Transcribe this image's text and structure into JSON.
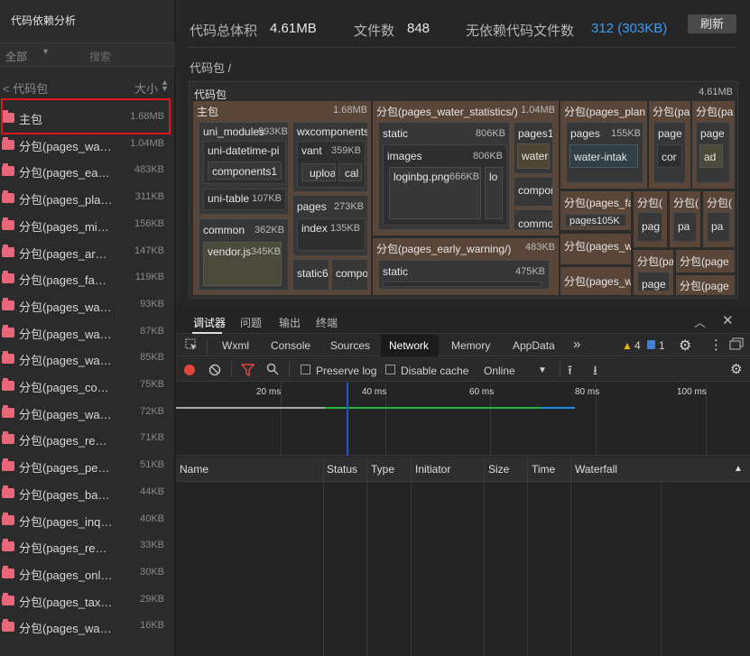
{
  "sidebar": {
    "title": "代码依赖分析",
    "filter_select": "全部",
    "search_placeholder": "搜索",
    "back_label": "< 代码包",
    "size_header": "大小",
    "items": [
      {
        "name": "主包",
        "size": "1.68MB"
      },
      {
        "name": "分包(pages_wat...",
        "size": "1.04MB"
      },
      {
        "name": "分包(pages_early...",
        "size": "483KB"
      },
      {
        "name": "分包(pages_plan/)",
        "size": "311KB"
      },
      {
        "name": "分包(pages_min...",
        "size": "156KB"
      },
      {
        "name": "分包(pages_archi...",
        "size": "147KB"
      },
      {
        "name": "分包(pages_fault...",
        "size": "119KB"
      },
      {
        "name": "分包(pages_water...",
        "size": "93KB"
      },
      {
        "name": "分包(pages_water...",
        "size": "87KB"
      },
      {
        "name": "分包(pages_water...",
        "size": "85KB"
      },
      {
        "name": "分包(pages_consu...",
        "size": "75KB"
      },
      {
        "name": "分包(pages_water...",
        "size": "72KB"
      },
      {
        "name": "分包(pages_recor...",
        "size": "71KB"
      },
      {
        "name": "分包(pages_permi...",
        "size": "51KB"
      },
      {
        "name": "分包(pages_baro...",
        "size": "44KB"
      },
      {
        "name": "分包(pages_inquir...",
        "size": "40KB"
      },
      {
        "name": "分包(pages_regist...",
        "size": "33KB"
      },
      {
        "name": "分包(pages_onlin...",
        "size": "30KB"
      },
      {
        "name": "分包(pages_taxes...",
        "size": "29KB"
      },
      {
        "name": "分包(pages_water...",
        "size": "16KB"
      }
    ]
  },
  "stats": {
    "total_label": "代码总体积",
    "total_value": "4.61MB",
    "files_label": "文件数",
    "files_value": "848",
    "nodep_label": "无依赖代码文件数",
    "nodep_value": "312 (303KB)",
    "refresh_label": "刷新"
  },
  "breadcrumb": "代码包 /",
  "treemap": {
    "title": "代码包",
    "size": "4.61MB",
    "main": {
      "label": "主包",
      "size": "1.68MB"
    },
    "uni_modules": {
      "label": "uni_modules",
      "size": "593KB"
    },
    "uni_datetime": {
      "label": "uni-datetime-pi",
      "child": "components1"
    },
    "uni_table": {
      "label": "uni-table",
      "size": "107KB"
    },
    "wxcomponents": {
      "label": "wxcomponents"
    },
    "vant": {
      "label": "vant",
      "size": "359KB",
      "child_a": "uploa",
      "child_b": "cal"
    },
    "pages": {
      "label": "pages",
      "size": "273KB"
    },
    "index": {
      "label": "index",
      "size": "135KB"
    },
    "common": {
      "label": "common",
      "size": "362KB"
    },
    "vendor": {
      "label": "vendor.js",
      "size": "345KB"
    },
    "static_main": {
      "label": "static6"
    },
    "compo_main": {
      "label": "compo"
    },
    "ws": {
      "label": "分包(pages_water_statistics/)",
      "size": "1.04MB"
    },
    "ws_static": {
      "label": "static",
      "size": "806KB"
    },
    "ws_images": {
      "label": "images",
      "size": "806KB"
    },
    "ws_login": {
      "label": "loginbg.png",
      "size": "666KB"
    },
    "ws_lo": {
      "label": "lo"
    },
    "ws_pages": {
      "label": "pages13"
    },
    "ws_water": {
      "label": "water"
    },
    "ws_compo": {
      "label": "compor"
    },
    "ws_common": {
      "label": "commo"
    },
    "ew": {
      "label": "分包(pages_early_warning/)",
      "size": "483KB"
    },
    "ew_static": {
      "label": "static",
      "size": "475KB"
    },
    "plan": {
      "label": "分包(pages_plan"
    },
    "plan_pages": {
      "label": "pages",
      "size": "155KB"
    },
    "plan_water": {
      "label": "water-intak"
    },
    "sub_pa1": {
      "label": "分包(pa"
    },
    "sub_pa1_pages": {
      "label": "page"
    },
    "sub_pa1_cor": {
      "label": "cor"
    },
    "sub_pa2": {
      "label": "分包(pa"
    },
    "sub_pa2_page": {
      "label": "page"
    },
    "sub_pa2_ad": {
      "label": "ad"
    },
    "fa": {
      "label": "分包(pages_fa"
    },
    "fa_pages": {
      "label": "pages105K"
    },
    "wa": {
      "label": "分包(pages_w"
    },
    "wa2": {
      "label": "分包(pages_w"
    },
    "sm_a": {
      "label": "分包("
    },
    "sm_a_pag": {
      "label": "pag"
    },
    "sm_b": {
      "label": "分包("
    },
    "sm_b_pa": {
      "label": "pa"
    },
    "sm_c": {
      "label": "分包("
    },
    "sm_c_pa": {
      "label": "pa"
    },
    "sm_d": {
      "label": "分包(pa"
    },
    "sm_d_page": {
      "label": "page"
    },
    "sm_e": {
      "label": "分包(page"
    },
    "sm_f": {
      "label": "分包(page"
    }
  },
  "devtools": {
    "tabs": [
      "调试器",
      "问题",
      "输出",
      "终端"
    ],
    "panel_tabs": [
      "Wxml",
      "Console",
      "Sources",
      "Network",
      "Memory",
      "AppData"
    ],
    "more": "»",
    "warnings": "4",
    "messages": "1",
    "preserve_log": "Preserve log",
    "disable_cache": "Disable cache",
    "throttling": "Online",
    "ticks": [
      "20 ms",
      "40 ms",
      "60 ms",
      "80 ms",
      "100 ms"
    ],
    "columns": [
      "Name",
      "Status",
      "Type",
      "Initiator",
      "Size",
      "Time",
      "Waterfall"
    ],
    "colors": {
      "record": "#e0443c",
      "filter": "#e0443c",
      "blue": "#1e88e5",
      "green": "#27b43e",
      "marker": "#2152d8"
    }
  }
}
